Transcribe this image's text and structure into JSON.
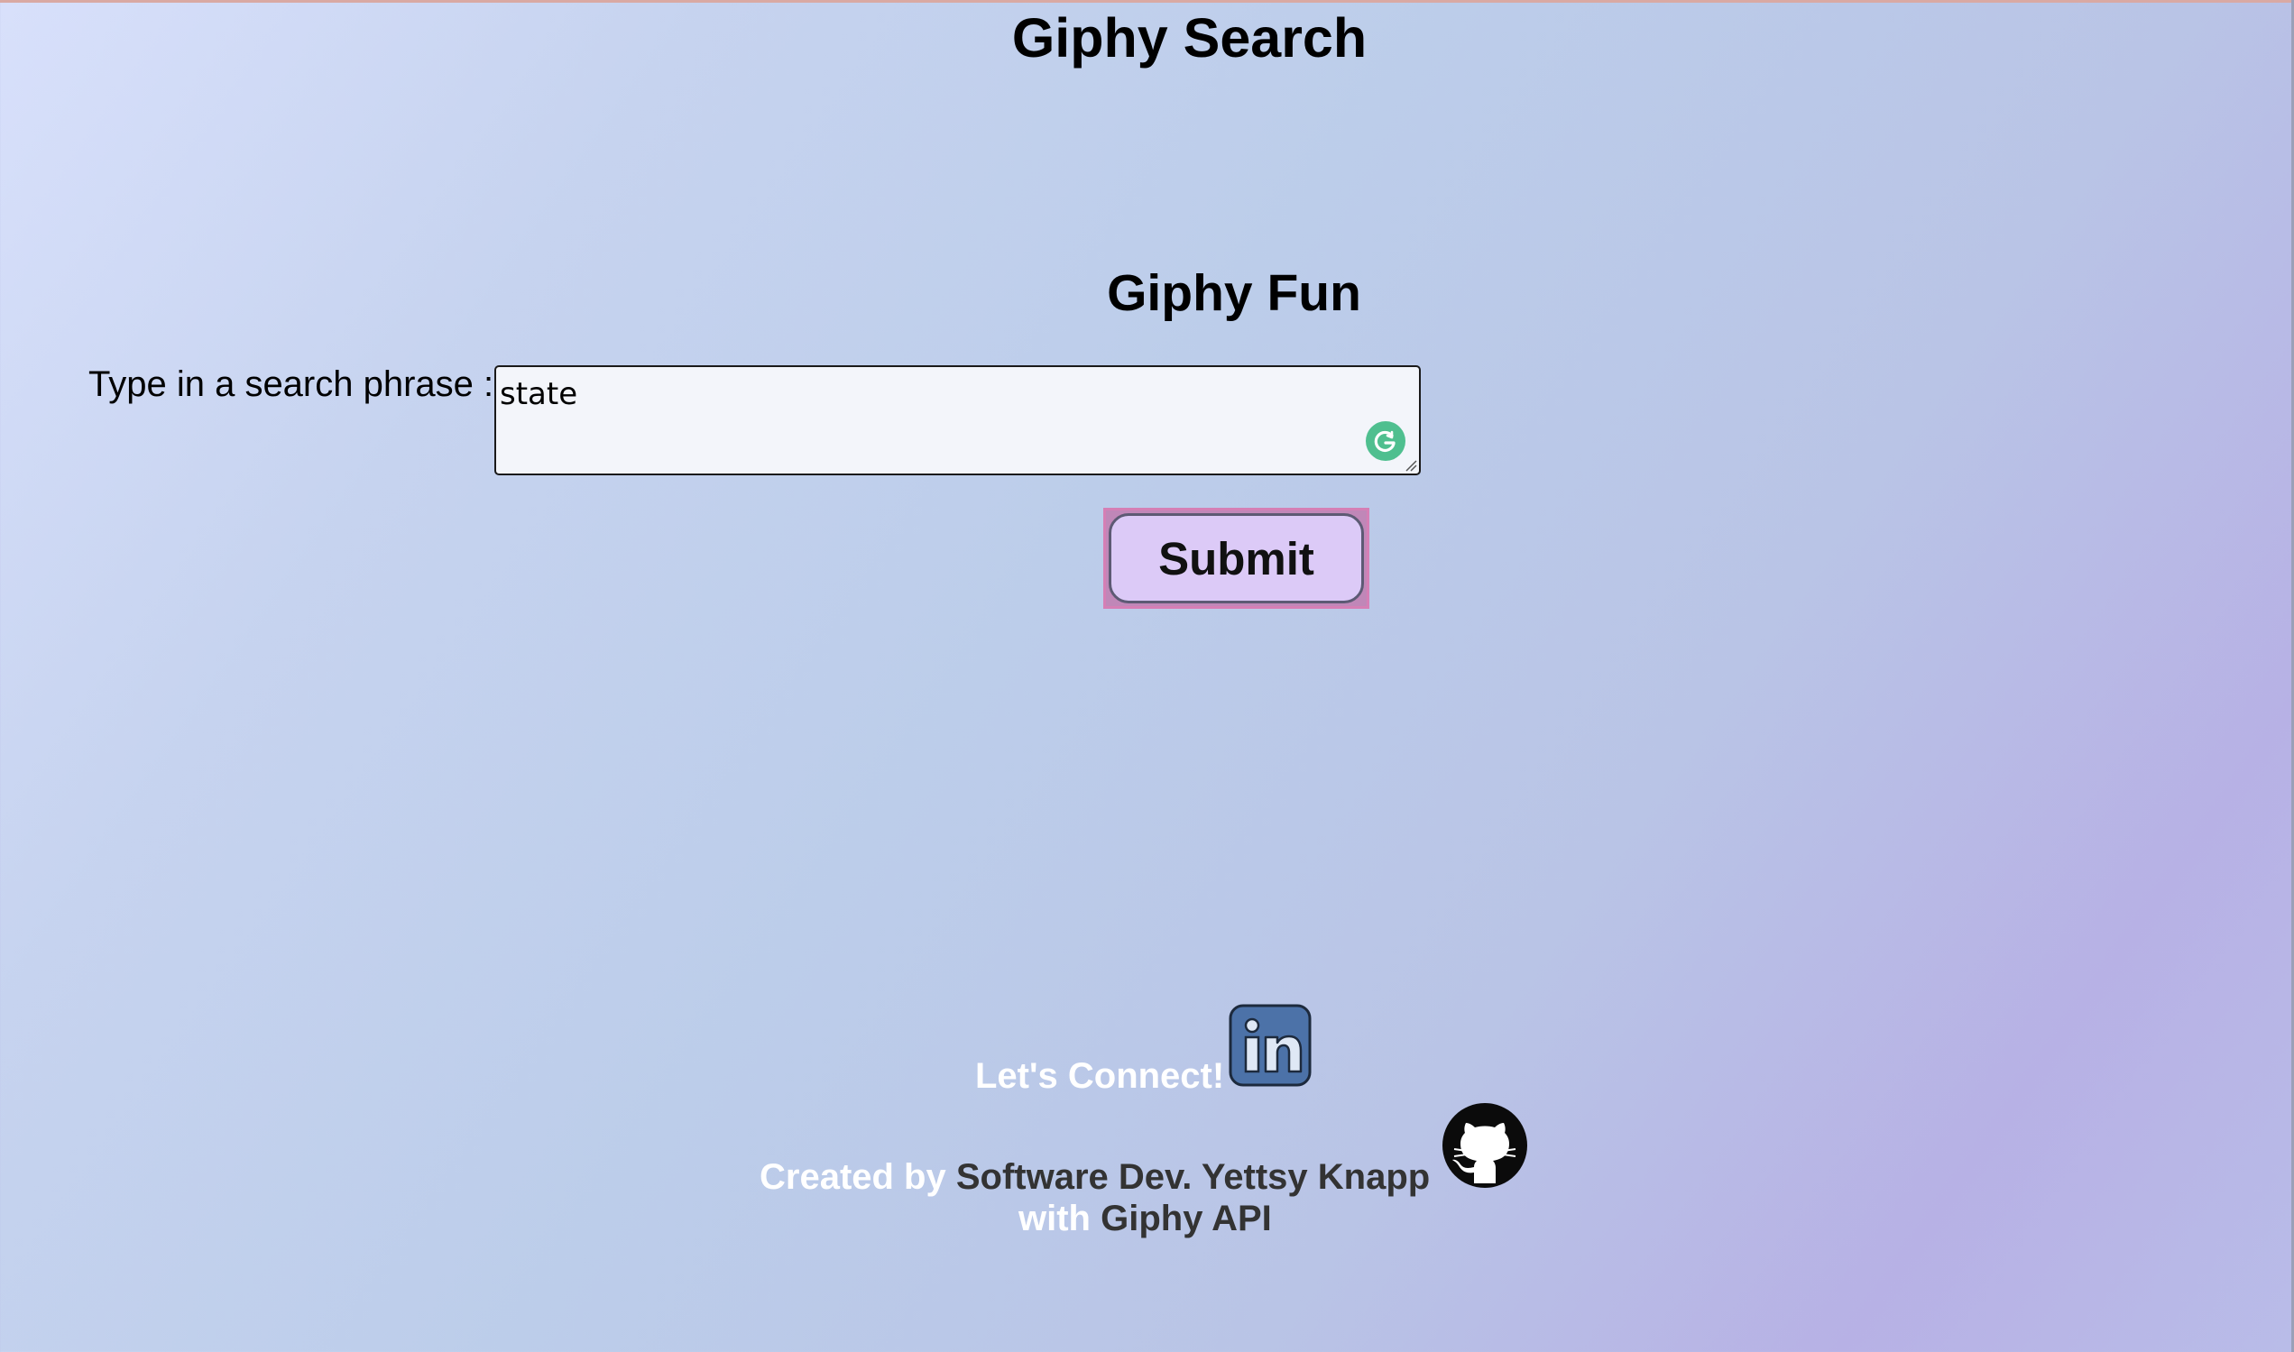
{
  "header": {
    "title": "Giphy Search"
  },
  "main": {
    "section_title": "Giphy Fun",
    "search": {
      "label": "Type in a search phrase :",
      "value": "state"
    },
    "submit_label": "Submit"
  },
  "footer": {
    "connect_text": "Let's Connect!",
    "created_by_prefix": "Created by ",
    "author_link": "Software Dev. Yettsy Knapp",
    "with_prefix": "with ",
    "api_link": "Giphy API",
    "icons": {
      "linkedin": "linkedin-icon",
      "github": "github-icon",
      "grammar_assistant": "grammar-assistant-icon"
    }
  },
  "colors": {
    "accent_button": "#dccaf7",
    "button_border": "#d57fb5",
    "assistant_icon": "#4fbf8f",
    "linkedin_blue": "#4c72a8",
    "footer_text": "#ffffff",
    "footer_link": "#333333"
  }
}
